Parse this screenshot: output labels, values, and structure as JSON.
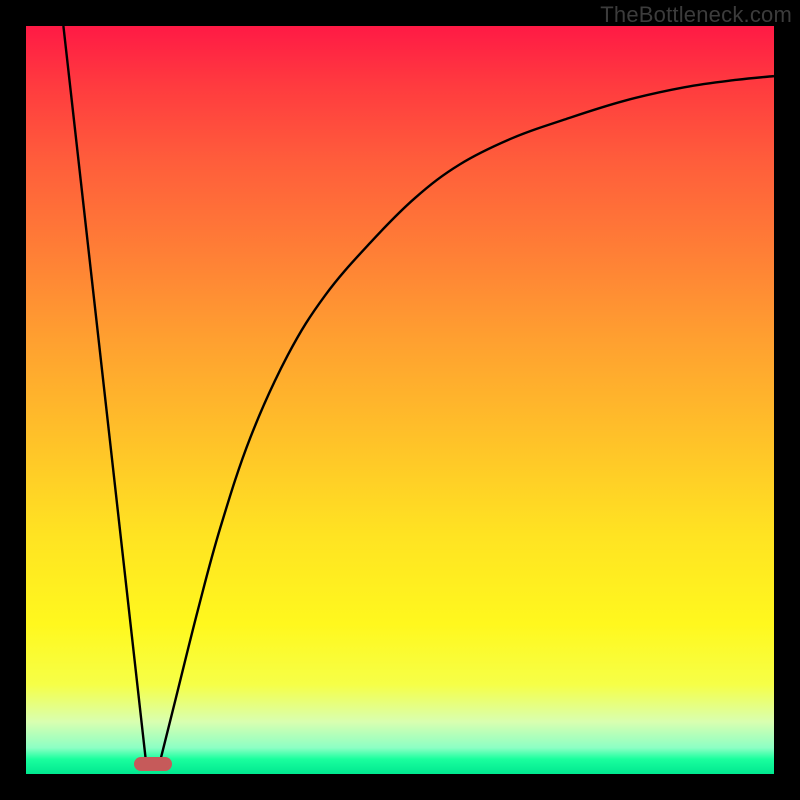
{
  "watermark": "TheBottleneck.com",
  "chart_data": {
    "type": "line",
    "title": "",
    "xlabel": "",
    "ylabel": "",
    "xlim": [
      0,
      100
    ],
    "ylim": [
      0,
      100
    ],
    "series": [
      {
        "name": "left-line",
        "x": [
          5,
          16
        ],
        "y": [
          100,
          2
        ]
      },
      {
        "name": "right-curve",
        "x": [
          18,
          20,
          23,
          26,
          30,
          35,
          40,
          46,
          52,
          58,
          65,
          72,
          80,
          88,
          95,
          100
        ],
        "y": [
          2,
          10,
          22,
          33,
          45,
          56,
          64,
          71,
          77,
          81.5,
          85,
          87.5,
          90,
          91.8,
          92.8,
          93.3
        ]
      }
    ],
    "marker": {
      "x": 17,
      "y": 1.4
    },
    "gradient_stops": [
      {
        "pos": 0,
        "color": "#ff1a45"
      },
      {
        "pos": 8,
        "color": "#ff3b3f"
      },
      {
        "pos": 18,
        "color": "#ff5d3b"
      },
      {
        "pos": 30,
        "color": "#ff7e36"
      },
      {
        "pos": 42,
        "color": "#ffa030"
      },
      {
        "pos": 55,
        "color": "#ffc129"
      },
      {
        "pos": 68,
        "color": "#ffe322"
      },
      {
        "pos": 80,
        "color": "#fff81e"
      },
      {
        "pos": 88,
        "color": "#f6ff47"
      },
      {
        "pos": 93,
        "color": "#d9ffb0"
      },
      {
        "pos": 96.5,
        "color": "#8cffc4"
      },
      {
        "pos": 98,
        "color": "#1aff9e"
      },
      {
        "pos": 100,
        "color": "#00e890"
      }
    ]
  }
}
